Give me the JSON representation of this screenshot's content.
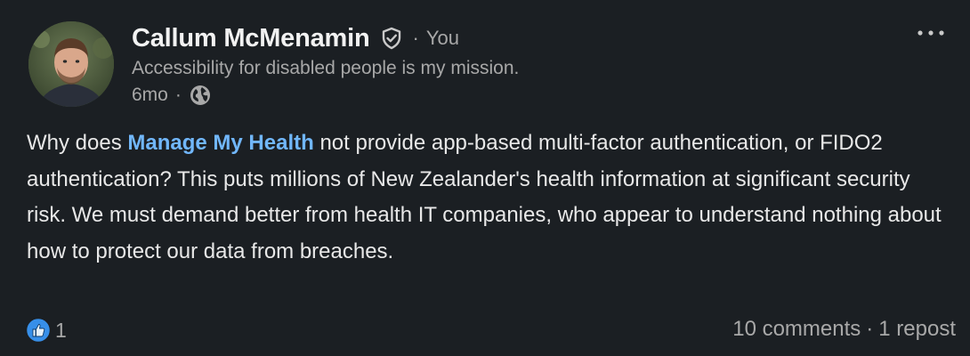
{
  "author": {
    "name": "Callum McMenamin",
    "relation": "You",
    "headline": "Accessibility for disabled people is my mission.",
    "time_ago": "6mo",
    "visibility_icon": "globe-icon",
    "verified_icon": "verified-shield-icon"
  },
  "post": {
    "text_before": "Why does ",
    "mention": "Manage My Health",
    "text_after": " not provide app-based multi-factor authentication, or FIDO2 authentication? This puts millions of New Zealander's health information at significant security risk. We must demand better from health IT companies, who appear to understand nothing about how to protect our data from breaches."
  },
  "footer": {
    "reaction_icon": "like-icon",
    "reaction_count": "1",
    "comments": "10 comments",
    "separator": "·",
    "reposts": "1 repost"
  },
  "menu": {
    "more_icon": "more-horizontal-icon"
  },
  "colors": {
    "background": "#1b1f23",
    "link": "#71b7fb",
    "muted": "#a8a8a8",
    "like_blue": "#378fe9"
  }
}
